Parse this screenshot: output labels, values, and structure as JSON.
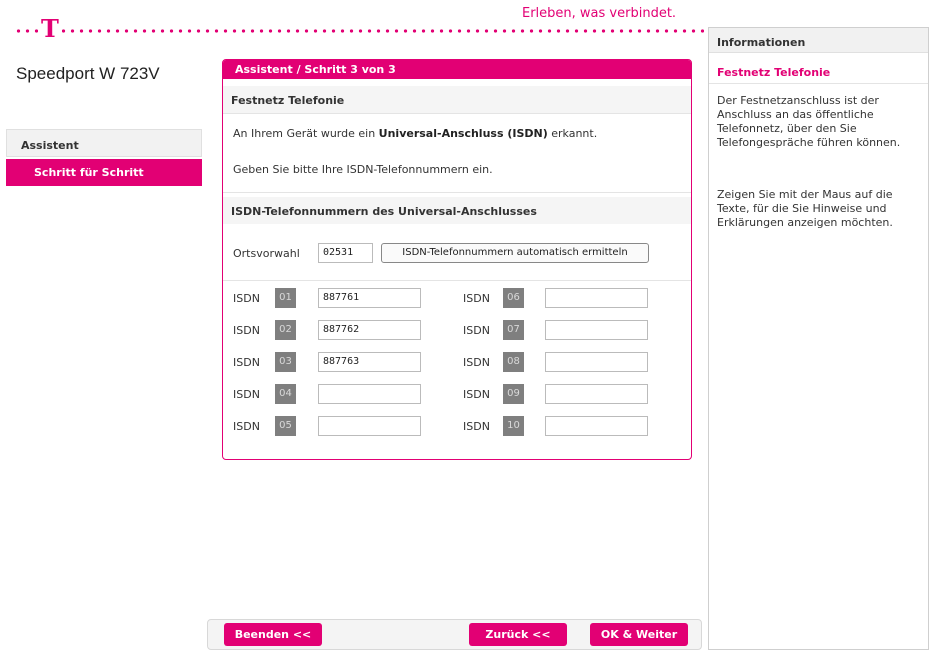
{
  "brand": {
    "tagline": "Erleben, was verbindet.",
    "logo": "T",
    "product": "Speedport W 723V",
    "accent": "#e20074"
  },
  "sidebar": {
    "heading": "Assistent",
    "items": [
      {
        "label": "Schritt für Schritt",
        "active": true
      }
    ]
  },
  "panel": {
    "title": "Assistent / Schritt 3 von 3",
    "section1_title": "Festnetz Telefonie",
    "text1_pre": "An Ihrem Gerät wurde ein ",
    "text1_bold": "Universal-Anschluss (ISDN)",
    "text1_post": " erkannt.",
    "text2": "Geben Sie bitte Ihre ISDN-Telefonnummern ein.",
    "section2_title": "ISDN-Telefonnummern des Universal-Anschlusses",
    "area_code_label": "Ortsvorwahl",
    "area_code_value": "02531",
    "auto_button": "ISDN-Telefonnummern automatisch ermitteln",
    "isdn_label": "ISDN",
    "isdn": [
      {
        "num": "01",
        "value": "887761"
      },
      {
        "num": "02",
        "value": "887762"
      },
      {
        "num": "03",
        "value": "887763"
      },
      {
        "num": "04",
        "value": ""
      },
      {
        "num": "05",
        "value": ""
      },
      {
        "num": "06",
        "value": ""
      },
      {
        "num": "07",
        "value": ""
      },
      {
        "num": "08",
        "value": ""
      },
      {
        "num": "09",
        "value": ""
      },
      {
        "num": "10",
        "value": ""
      }
    ]
  },
  "footer": {
    "quit": "Beenden <<",
    "back": "Zurück <<",
    "next": "OK & Weiter"
  },
  "info": {
    "heading": "Informationen",
    "subheading": "Festnetz Telefonie",
    "p1": "Der Festnetzanschluss ist der Anschluss an das öffentliche Telefonnetz, über den Sie Telefongespräche führen können.",
    "p2": "Zeigen Sie mit der Maus auf die Texte, für die Sie Hinweise und Erklärungen anzeigen möchten."
  }
}
